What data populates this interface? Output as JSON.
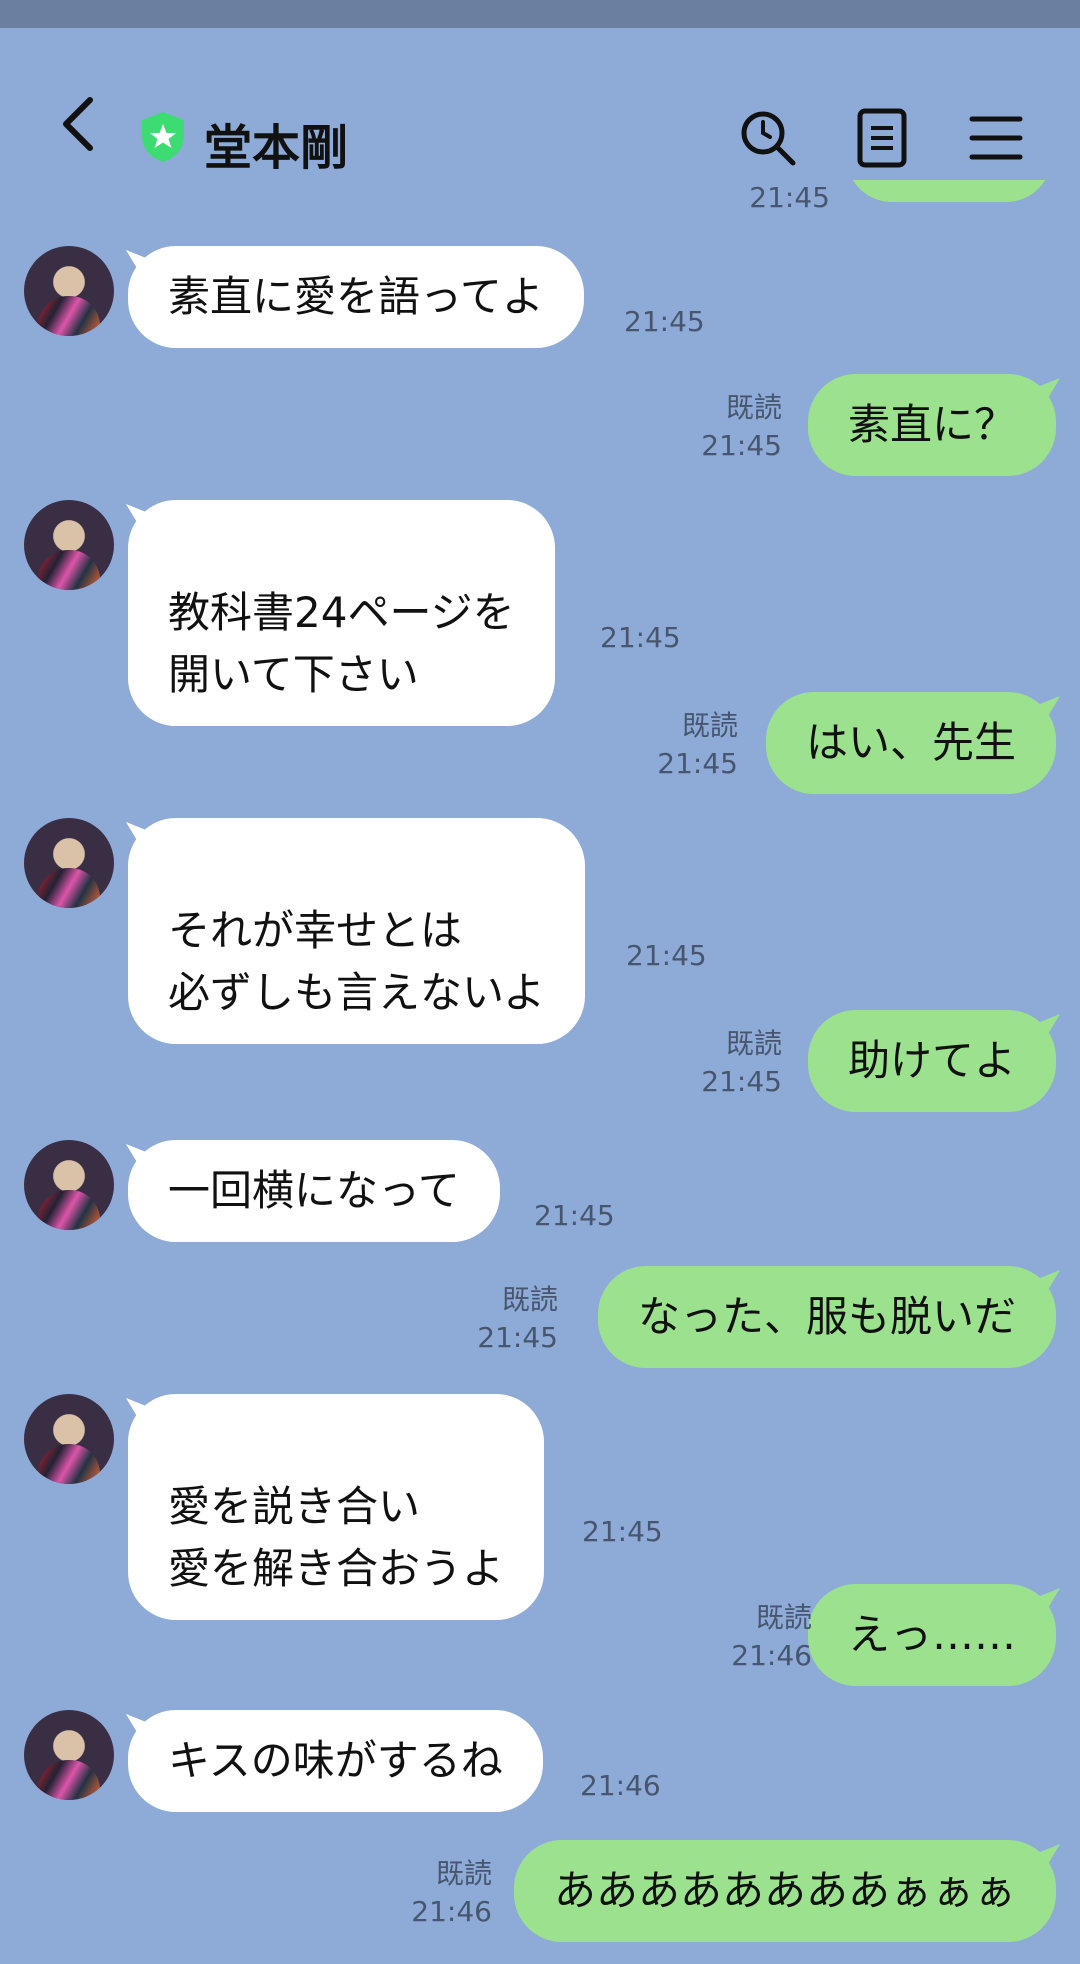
{
  "header": {
    "title": "堂本剛",
    "back_icon": "chevron-left-icon",
    "badge_icon": "verified-shield-icon",
    "badge_color": "#3ddc72",
    "actions": [
      "search-icon",
      "notes-icon",
      "menu-icon"
    ]
  },
  "partial_top": {
    "time": "21:45"
  },
  "messages": [
    {
      "dir": "in",
      "text": "素直に愛を語ってよ",
      "time": "21:45"
    },
    {
      "dir": "out",
      "text": "素直に？",
      "read": "既読",
      "time": "21:45"
    },
    {
      "dir": "in",
      "text": "教科書24ページを\n開いて下さい",
      "time": "21:45"
    },
    {
      "dir": "out",
      "text": "はい、先生",
      "read": "既読",
      "time": "21:45"
    },
    {
      "dir": "in",
      "text": "それが幸せとは\n必ずしも言えないよ",
      "time": "21:45"
    },
    {
      "dir": "out",
      "text": "助けてよ",
      "read": "既読",
      "time": "21:45"
    },
    {
      "dir": "in",
      "text": "一回横になって",
      "time": "21:45"
    },
    {
      "dir": "out",
      "text": "なった、服も脱いだ",
      "read": "既読",
      "time": "21:45"
    },
    {
      "dir": "in",
      "text": "愛を説き合い\n愛を解き合おうよ",
      "time": "21:45"
    },
    {
      "dir": "out",
      "text": "えっ……",
      "read": "既読",
      "time": "21:46"
    },
    {
      "dir": "in",
      "text": "キスの味がするね",
      "time": "21:46"
    },
    {
      "dir": "out",
      "text": "ああああああああぁぁぁ",
      "read": "既読",
      "time": "21:46"
    }
  ],
  "colors": {
    "background": "#8eabd8",
    "incoming_bubble": "#ffffff",
    "outgoing_bubble": "#9ce28e"
  }
}
